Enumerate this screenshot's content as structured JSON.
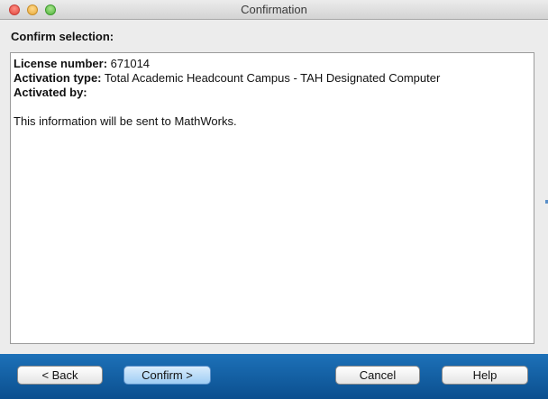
{
  "window": {
    "title": "Confirmation"
  },
  "heading": "Confirm selection:",
  "details": {
    "license_label": "License number:",
    "license_value": "671014",
    "activation_label": "Activation type:",
    "activation_value": "Total Academic Headcount Campus - TAH Designated Computer",
    "activated_by_label": "Activated by:",
    "activated_by_value": "",
    "info": "This information will be sent to MathWorks."
  },
  "buttons": {
    "back": "< Back",
    "confirm": "Confirm >",
    "cancel": "Cancel",
    "help": "Help"
  }
}
